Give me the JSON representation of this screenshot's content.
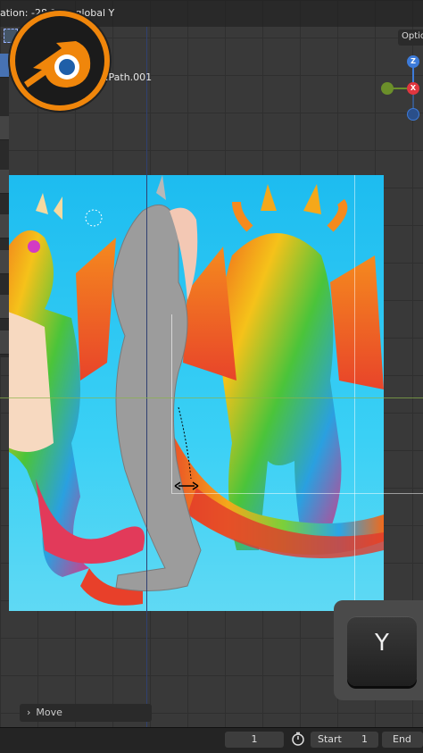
{
  "header": {
    "transform_status": "ation: -28.1      global Y"
  },
  "tabs": {
    "options": "Optio"
  },
  "object": {
    "name": ".Path.001"
  },
  "gizmo": {
    "z_axis": "Z",
    "x_axis": "X",
    "z_color": "#3d7bd9",
    "x_color": "#e0363f",
    "y_color": "#6b8f2a"
  },
  "keycap": {
    "key": "Y"
  },
  "operator_panel": {
    "label": "Move",
    "chevron": "chevron-right-icon"
  },
  "timeline": {
    "current_frame": "1",
    "start_label": "Start",
    "start_value": "1",
    "end_label": "End"
  },
  "logo": {
    "icon": "blender-logo"
  }
}
